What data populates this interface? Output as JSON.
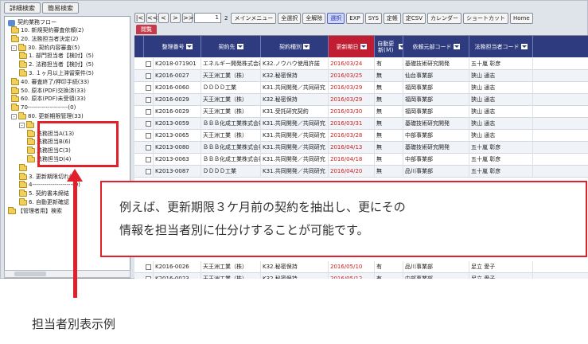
{
  "tabs": [
    "詳細検索",
    "簡易検索"
  ],
  "tree": {
    "root": "契約業務フロー",
    "items": [
      {
        "label": "10. 新規契約審査依頼(2)",
        "level": 1
      },
      {
        "label": "20. 法務担当者決定(2)",
        "level": 1
      },
      {
        "label": "30. 契約内容審査(5)",
        "level": 1,
        "expander": "-"
      },
      {
        "label": "1. 部門担当者【検討】(5)",
        "level": 2
      },
      {
        "label": "2. 法務担当者【検討】(5)",
        "level": 2
      },
      {
        "label": "3. １ヶ月以上滞留案件(5)",
        "level": 2
      },
      {
        "label": "40. 審査終了/押印手続(33)",
        "level": 1
      },
      {
        "label": "50. 原本(PDF)交換済(33)",
        "level": 1
      },
      {
        "label": "60. 原本(PDF)未受領(33)",
        "level": 1
      },
      {
        "label": "70--------------------(0)",
        "level": 1
      },
      {
        "label": "80. 更新期限管理(33)",
        "level": 1,
        "expander": "-"
      },
      {
        "label": "",
        "level": 2,
        "expander": "-"
      },
      {
        "label": "法務担当A(13)",
        "level": 3
      },
      {
        "label": "法務担当B(6)",
        "level": 3
      },
      {
        "label": "法務担当C(3)",
        "level": 3
      },
      {
        "label": "法務担当D(4)",
        "level": 3
      },
      {
        "label": "",
        "level": 2
      },
      {
        "label": "3. 更新期限切れ(5)",
        "level": 2
      },
      {
        "label": "4--------------------(0)",
        "level": 2
      },
      {
        "label": "5. 契約書未締結",
        "level": 2
      },
      {
        "label": "6. 自動更新確認",
        "level": 2
      },
      {
        "label": "【管理者用】検索",
        "level": 0
      }
    ]
  },
  "toolbar": {
    "nav": [
      "|<",
      "<<",
      "<",
      ">",
      ">>"
    ],
    "page_current": "1",
    "page_total": "2",
    "buttons": [
      "メインメニュー",
      "全選択",
      "全解除",
      "選択",
      "EXP",
      "SYS",
      "定帳",
      "定CSV",
      "カレンダー",
      "ショートカット",
      "Home"
    ],
    "active_button": "選択"
  },
  "subtab": "閲覧",
  "grid": {
    "columns": [
      "整理番号",
      "契約先",
      "契約種別",
      "更新期日",
      "自動更新(Ｍ)",
      "依頼元部コード",
      "法務担当者コード"
    ],
    "rows": [
      [
        "K2018-071901",
        "エネルギー開発株式会社",
        "K32.ノウハウ使用許諾",
        "2016/03/24",
        "有",
        "基礎技術研究開発",
        "五十嵐 彰彦"
      ],
      [
        "K2016-0027",
        "天王洲工業（株）",
        "K32.秘密保持",
        "2016/03/25",
        "無",
        "仙台事業部",
        "狭山 通志"
      ],
      [
        "K2016-0060",
        "ＤＤＤＤ工業",
        "K31.共同開発／共同研究",
        "2016/03/29",
        "無",
        "福岡事業部",
        "狭山 通志"
      ],
      [
        "K2016-0029",
        "天王洲工業（株）",
        "K32.秘密保持",
        "2016/03/29",
        "無",
        "福岡事業部",
        "狭山 通志"
      ],
      [
        "K2016-0029",
        "天王洲工業（株）",
        "K31.受託研究契約",
        "2016/03/30",
        "無",
        "福岡事業部",
        "狭山 通志"
      ],
      [
        "K2013-0059",
        "ＢＢＢ化成工業株式会社",
        "K31.共同開発／共同研究",
        "2016/03/31",
        "無",
        "基礎技術研究開発",
        "狭山 通志"
      ],
      [
        "K2013-0065",
        "天王洲工業（株）",
        "K31.共同開発／共同研究",
        "2016/03/28",
        "無",
        "中部事業部",
        "狭山 通志"
      ],
      [
        "K2013-0080",
        "ＢＢＢ化成工業株式会社",
        "K31.共同開発／共同研究",
        "2016/04/13",
        "無",
        "基礎技術研究開発",
        "五十嵐 彰彦"
      ],
      [
        "K2013-0063",
        "ＢＢＢ化成工業株式会社",
        "K31.共同開発／共同研究",
        "2016/04/18",
        "無",
        "中部事業部",
        "五十嵐 彰彦"
      ],
      [
        "K2013-0087",
        "ＤＤＤＤ工業",
        "K31.共同開発／共同研究",
        "2016/04/20",
        "無",
        "品川事業部",
        "五十嵐 彰彦"
      ],
      [
        "K2016-0026",
        "天王洲工業（株）",
        "K32.秘密保持",
        "2016/05/10",
        "有",
        "品川事業部",
        "足立 愛子"
      ],
      [
        "K2016-0023",
        "天王洲工業（株）",
        "K32.秘密保持",
        "2016/05/12",
        "有",
        "中部事業部",
        "足立 愛子"
      ]
    ]
  },
  "callout": {
    "line1": "例えば、更新期限３ケ月前の契約を抽出し、更にその",
    "line2": "情報を担当者別に仕分けすることが可能です。"
  },
  "caption": "担当者別表示例",
  "colors": {
    "accent": "#e0202a",
    "header": "#2e3b7e",
    "date": "#d01c1c"
  }
}
